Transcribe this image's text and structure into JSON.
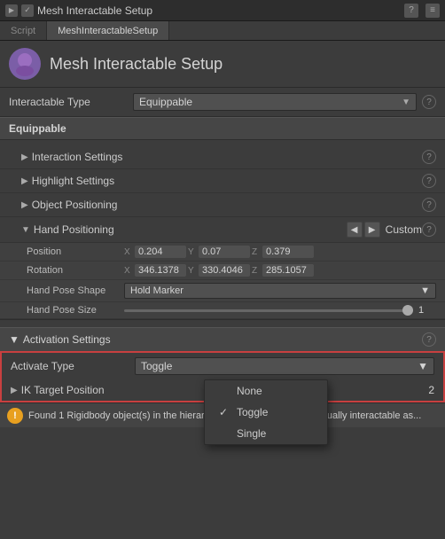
{
  "titleBar": {
    "title": "Mesh Interactable Setup",
    "icon": "▶",
    "helpBtn": "?",
    "menuBtn": "≡"
  },
  "tabs": [
    {
      "label": "Script",
      "active": false
    },
    {
      "label": "MeshInteractableSetup",
      "active": true
    }
  ],
  "header": {
    "title": "Mesh Interactable Setup",
    "icon": "👋"
  },
  "interactableType": {
    "label": "Interactable Type",
    "value": "Equippable",
    "help": "?"
  },
  "equippable": {
    "label": "Equippable"
  },
  "sections": {
    "interactionSettings": {
      "label": "Interaction Settings",
      "collapsed": true,
      "help": "?"
    },
    "highlightSettings": {
      "label": "Highlight Settings",
      "collapsed": true,
      "help": "?"
    },
    "objectPositioning": {
      "label": "Object Positioning",
      "collapsed": true,
      "help": "?"
    },
    "handPositioning": {
      "label": "Hand Positioning",
      "collapsed": false,
      "navLeft": "◀",
      "navRight": "▶",
      "navValue": "Custom",
      "help": "?"
    }
  },
  "handFields": {
    "position": {
      "label": "Position",
      "x": "0.204",
      "y": "0.07",
      "z": "0.379"
    },
    "rotation": {
      "label": "Rotation",
      "x": "346.1378",
      "y": "330.4046",
      "z": "285.1057"
    },
    "handPoseShape": {
      "label": "Hand Pose Shape",
      "value": "Hold Marker"
    },
    "handPoseSize": {
      "label": "Hand Pose Size",
      "value": "1"
    }
  },
  "activationSection": {
    "label": "Activation Settings",
    "arrow": "▼",
    "help": "?"
  },
  "activateType": {
    "label": "Activate Type",
    "value": "Toggle"
  },
  "dropdown": {
    "options": [
      {
        "label": "None",
        "checked": false
      },
      {
        "label": "Toggle",
        "checked": true
      },
      {
        "label": "Single",
        "checked": false
      }
    ]
  },
  "ikTarget": {
    "label": "IK Target Position",
    "arrow": "▶",
    "value": "2"
  },
  "bottomBar": {
    "icon": "!",
    "text": "Found 1 Rigidbody object(s) in the hierarchy below that will be individually interactable as..."
  }
}
